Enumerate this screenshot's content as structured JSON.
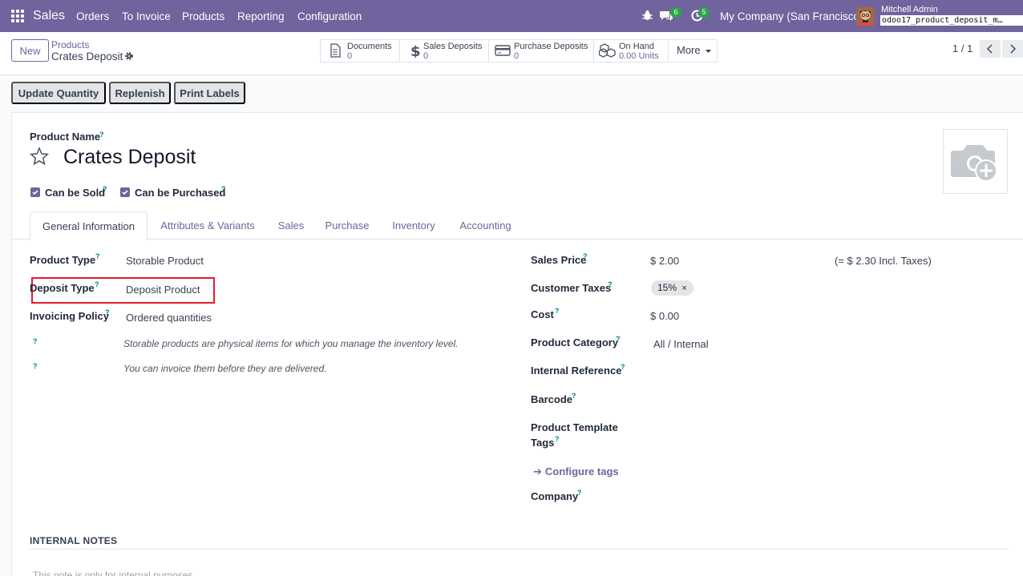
{
  "nav": {
    "app_name": "Sales",
    "menu": [
      "Orders",
      "To Invoice",
      "Products",
      "Reporting",
      "Configuration"
    ],
    "chat_count": "6",
    "activity_count": "5",
    "company": "My Company (San Francisco)",
    "user": "Mitchell Admin",
    "database": "odoo17_product_deposit_m…"
  },
  "control": {
    "new_label": "New",
    "breadcrumb_parent": "Products",
    "breadcrumb_current": "Crates Deposit",
    "stats": [
      {
        "label": "Documents",
        "value": "0"
      },
      {
        "label": "Sales Deposits",
        "value": "0"
      },
      {
        "label": "Purchase Deposits",
        "value": "0"
      },
      {
        "label": "On Hand",
        "value": "0.00 Units"
      }
    ],
    "more_label": "More",
    "pager": "1 / 1"
  },
  "actions": [
    "Update Quantity",
    "Replenish",
    "Print Labels"
  ],
  "form": {
    "product_name_label": "Product Name",
    "product_name": "Crates Deposit",
    "can_be_sold": "Can be Sold",
    "can_be_purchased": "Can be Purchased",
    "tabs": [
      "General Information",
      "Attributes & Variants",
      "Sales",
      "Purchase",
      "Inventory",
      "Accounting"
    ],
    "left": {
      "product_type_label": "Product Type",
      "product_type": "Storable Product",
      "deposit_type_label": "Deposit Type",
      "deposit_type": "Deposit Product",
      "invoicing_policy_label": "Invoicing Policy",
      "invoicing_policy": "Ordered quantities",
      "note1": "Storable products are physical items for which you manage the inventory level.",
      "note2": "You can invoice them before they are delivered."
    },
    "right": {
      "sales_price_label": "Sales Price",
      "sales_price": "$ 2.00",
      "incl_taxes": "(= $ 2.30 Incl. Taxes)",
      "customer_taxes_label": "Customer Taxes",
      "customer_tax_tag": "15%",
      "cost_label": "Cost",
      "cost": "$ 0.00",
      "category_label": "Product Category",
      "category": "All / Internal",
      "internal_ref_label": "Internal Reference",
      "barcode_label": "Barcode",
      "template_tags_label_1": "Product Template",
      "template_tags_label_2": "Tags",
      "configure_tags": "Configure tags",
      "company_label": "Company"
    },
    "internal_notes_title": "INTERNAL NOTES",
    "internal_notes_placeholder": "This note is only for internal purposes."
  },
  "colors": {
    "brand": "#71639e",
    "highlight": "#e11d2c",
    "badge": "#28a745"
  }
}
